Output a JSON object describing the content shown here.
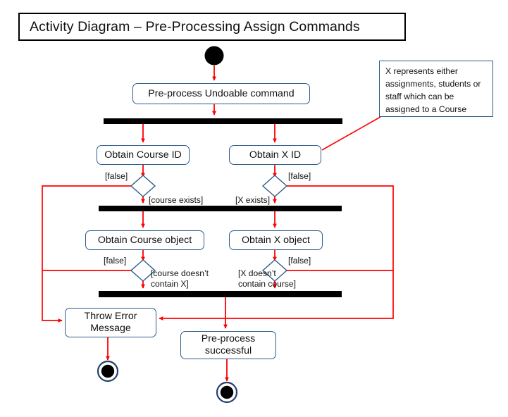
{
  "title": {
    "text": "Activity Diagram – Pre-Processing Assign Commands"
  },
  "note": {
    "text": "X represents either assignments, students or staff which can be assigned to a Course"
  },
  "nodes": {
    "start": "initial-node",
    "preprocess": "Pre-process Undoable command",
    "obtain_course_id": "Obtain Course ID",
    "obtain_x_id": "Obtain X ID",
    "obtain_course_object": "Obtain Course object",
    "obtain_x_object": "Obtain X object",
    "throw_error": "Throw Error Message",
    "preprocess_successful": "Pre-process successful"
  },
  "guards": {
    "false_1": "[false]",
    "false_2": "[false]",
    "course_exists": "[course exists]",
    "x_exists": "[X exists]",
    "false_3": "[false]",
    "false_4": "[false]",
    "course_doesnt_contain_x": "[course doesn’t contain X]",
    "x_doesnt_contain_course": "[X doesn’t contain course]"
  },
  "colors": {
    "flow": "#FF0000",
    "node_border": "#2E5C8A",
    "bar": "#000000",
    "title_border": "#000000",
    "background": "#FFFFFF"
  }
}
